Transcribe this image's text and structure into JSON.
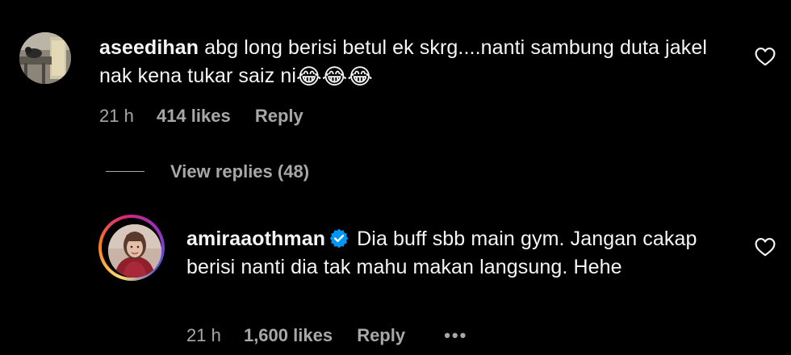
{
  "comments": [
    {
      "username": "aseedihan",
      "text": "abg long berisi betul ek skrg....nanti sambung duta jakel nak kena tukar saiz ni",
      "emojis": "😂😂😂",
      "time": "21 h",
      "likes": "414 likes",
      "reply_label": "Reply",
      "avatar_icon": "profile-photo"
    },
    {
      "username": "amiraaothman",
      "verified": true,
      "text": "Dia buff sbb main gym. Jangan cakap berisi nanti dia tak mahu makan langsung. Hehe",
      "time": "21 h",
      "likes": "1,600 likes",
      "reply_label": "Reply",
      "more_label": "•••",
      "avatar_icon": "profile-photo-story-ring"
    }
  ],
  "view_replies": {
    "label": "View replies (48)"
  },
  "icons": {
    "like": "heart-outline-icon",
    "verified": "verified-badge-icon"
  },
  "colors": {
    "background": "#000000",
    "primary_text": "#f5f5f5",
    "secondary_text": "#a8a8a8",
    "verified_blue": "#0095f6"
  }
}
